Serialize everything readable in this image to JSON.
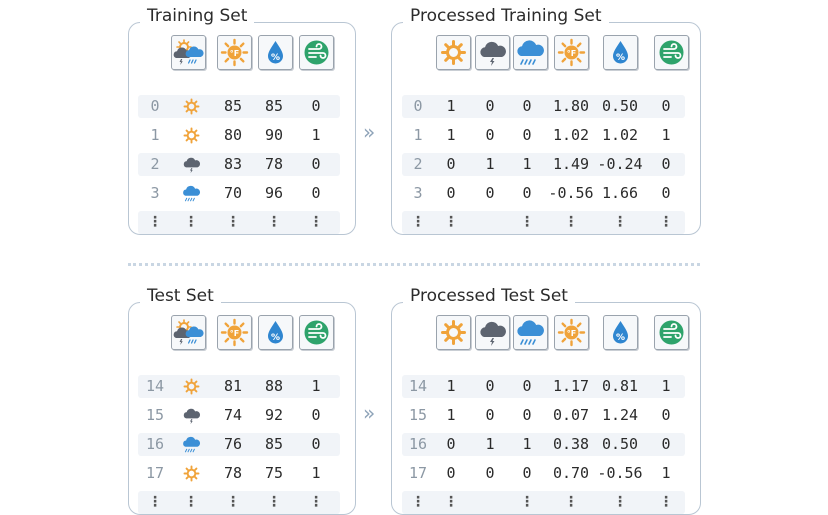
{
  "panels": {
    "training": {
      "title": "Training Set",
      "rows": [
        {
          "index": "0",
          "weather": "sun-icon",
          "temperature": "85",
          "humidity": "85",
          "windy": "0"
        },
        {
          "index": "1",
          "weather": "sun-icon",
          "temperature": "80",
          "humidity": "90",
          "windy": "1"
        },
        {
          "index": "2",
          "weather": "storm-cloud-icon",
          "temperature": "83",
          "humidity": "78",
          "windy": "0"
        },
        {
          "index": "3",
          "weather": "rain-cloud-icon",
          "temperature": "70",
          "humidity": "96",
          "windy": "0"
        }
      ],
      "ellipsis": "⋮"
    },
    "processed_training": {
      "title": "Processed Training Set",
      "rows": [
        {
          "index": "0",
          "sunny": "1",
          "cloudy": "0",
          "rainy": "0",
          "temperature": "1.80",
          "humidity": "0.50",
          "windy": "0"
        },
        {
          "index": "1",
          "sunny": "1",
          "cloudy": "0",
          "rainy": "0",
          "temperature": "1.02",
          "humidity": "1.02",
          "windy": "1"
        },
        {
          "index": "2",
          "sunny": "0",
          "cloudy": "1",
          "rainy": "1",
          "temperature": "1.49",
          "humidity": "-0.24",
          "windy": "0"
        },
        {
          "index": "3",
          "sunny": "0",
          "cloudy": "0",
          "rainy": "0",
          "temperature": "-0.56",
          "humidity": "1.66",
          "windy": "0"
        }
      ],
      "ellipsis": "⋮"
    },
    "test": {
      "title": "Test Set",
      "rows": [
        {
          "index": "14",
          "weather": "sun-icon",
          "temperature": "81",
          "humidity": "88",
          "windy": "1"
        },
        {
          "index": "15",
          "weather": "storm-cloud-icon",
          "temperature": "74",
          "humidity": "92",
          "windy": "0"
        },
        {
          "index": "16",
          "weather": "rain-cloud-icon",
          "temperature": "76",
          "humidity": "85",
          "windy": "0"
        },
        {
          "index": "17",
          "weather": "sun-icon",
          "temperature": "78",
          "humidity": "75",
          "windy": "1"
        }
      ],
      "ellipsis": "⋮"
    },
    "processed_test": {
      "title": "Processed Test Set",
      "rows": [
        {
          "index": "14",
          "sunny": "1",
          "cloudy": "0",
          "rainy": "0",
          "temperature": "1.17",
          "humidity": "0.81",
          "windy": "1"
        },
        {
          "index": "15",
          "sunny": "1",
          "cloudy": "0",
          "rainy": "0",
          "temperature": "0.07",
          "humidity": "1.24",
          "windy": "0"
        },
        {
          "index": "16",
          "sunny": "0",
          "cloudy": "1",
          "rainy": "1",
          "temperature": "0.38",
          "humidity": "0.50",
          "windy": "0"
        },
        {
          "index": "17",
          "sunny": "0",
          "cloudy": "0",
          "rainy": "0",
          "temperature": "0.70",
          "humidity": "-0.56",
          "windy": "1"
        }
      ],
      "ellipsis": "⋮"
    }
  },
  "header_icons": {
    "raw": [
      "weather-outlook-icon",
      "temperature-icon",
      "humidity-icon",
      "wind-icon"
    ],
    "processed": [
      "sun-icon",
      "storm-cloud-icon",
      "rain-cloud-icon",
      "temperature-icon",
      "humidity-icon",
      "wind-icon"
    ]
  },
  "arrow_glyph": "»",
  "colors": {
    "sun": "#f0a33a",
    "cloud_dark": "#5d6470",
    "cloud_blue": "#3b8fd6",
    "humidity": "#2f86d0",
    "wind": "#2ea36b",
    "panel_border": "#b9c6d3",
    "row_shade": "#f1f4f8"
  }
}
